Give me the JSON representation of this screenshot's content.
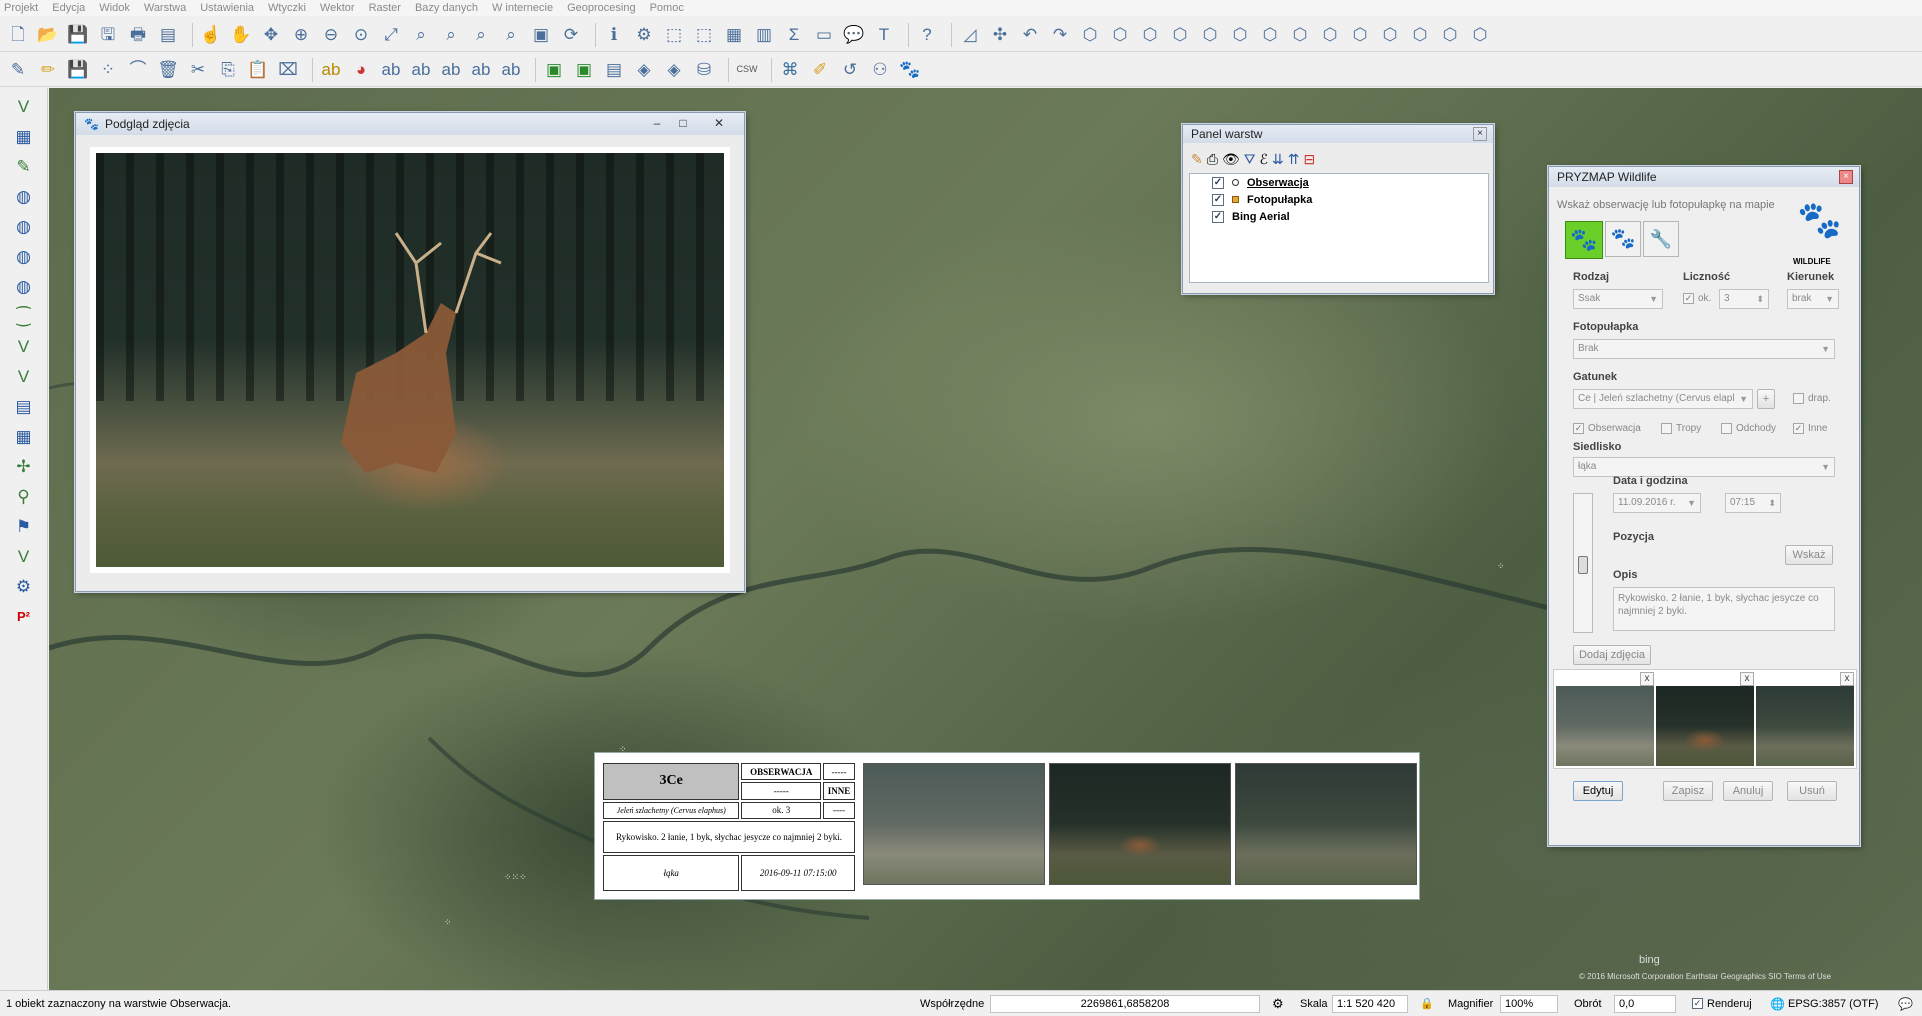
{
  "menubar": [
    "Projekt",
    "Edycja",
    "Widok",
    "Warstwa",
    "Ustawienia",
    "Wtyczki",
    "Wektor",
    "Raster",
    "Bazy danych",
    "W internecie",
    "Geoprocesing",
    "Pomoc"
  ],
  "icons": {
    "toolbar1": [
      "new-project-icon",
      "open-project-icon",
      "save-project-icon",
      "save-as-icon",
      "new-print-composer-icon",
      "composer-manager-icon",
      "touch-icon",
      "pan-icon",
      "pan-to-selection-icon",
      "zoom-in-icon",
      "zoom-out-icon",
      "zoom-native-icon",
      "zoom-full-icon",
      "zoom-to-selection-icon",
      "zoom-to-layer-icon",
      "zoom-last-icon",
      "zoom-next-icon",
      "new-map-view-icon",
      "refresh-icon",
      "identify-icon",
      "action-icon",
      "select-icon",
      "deselect-icon",
      "open-attribute-table-icon",
      "statistics-icon",
      "sum-icon",
      "measure-icon",
      "map-tips-icon",
      "text-annotation-icon",
      "help-icon",
      "digitize-icon",
      "move-feature-icon",
      "undo-icon",
      "redo-icon",
      "advanced-edit-icon"
    ],
    "toolbar2": [
      "current-edits-icon",
      "toggle-editing-icon",
      "save-edits-icon",
      "add-feature-icon",
      "node-tool-icon",
      "delete-selected-icon",
      "cut-icon",
      "copy-icon",
      "paste-icon",
      "label-icon",
      "diagram-icon",
      "label-pin-icon",
      "label-show-icon",
      "label-move-icon",
      "label-rotate-icon",
      "label-change-icon",
      "python-plugin-icon",
      "plugin-manager-icon",
      "map-layer-icon",
      "wms-icon",
      "wfs-icon",
      "database-icon",
      "csw-icon",
      "python-console-icon",
      "pencil-icon",
      "undo-blue-icon",
      "network-icon",
      "wildlife-paw-icon"
    ],
    "lefttb": [
      "add-vector-layer-icon",
      "add-raster-layer-icon",
      "add-postgis-icon",
      "add-spatialite-icon",
      "add-wms-icon",
      "add-wcs-icon",
      "add-wfs-icon",
      "add-csv-icon",
      "new-shapefile-icon",
      "new-spatialite-icon",
      "add-oracle-icon",
      "add-mssql-icon",
      "add-virtual-layer-icon",
      "gps-icon",
      "georeferencer-icon",
      "road-graph-icon",
      "processing-icon",
      "p2-icon"
    ]
  },
  "photo_window": {
    "title": "Podgląd zdjęcia"
  },
  "layers_panel": {
    "title": "Panel warstw",
    "layers": [
      {
        "name": "Obserwacja",
        "checked": true,
        "symbol": "circle"
      },
      {
        "name": "Fotopułapka",
        "checked": true,
        "symbol": "square"
      },
      {
        "name": "Bing Aerial",
        "checked": true,
        "symbol": ""
      }
    ]
  },
  "pryzmap": {
    "title": "PRYZMAP Wildlife",
    "hint": "Wskaż obserwację lub fotopułapkę na mapie",
    "logo_text": "WILDLIFE",
    "labels": {
      "rodzaj": "Rodzaj",
      "licznosc": "Liczność",
      "kierunek": "Kierunek",
      "fotopulapka": "Fotopułapka",
      "gatunek": "Gatunek",
      "siedlisko": "Siedlisko",
      "data": "Data i godzina",
      "pozycja": "Pozycja",
      "opis": "Opis"
    },
    "values": {
      "rodzaj": "Ssak",
      "ok_label": "ok.",
      "licznosc": "3",
      "kierunek": "brak",
      "fotopulapka": "Brak",
      "gatunek": "Ce | Jeleń szlachetny (Cervus elapl",
      "gatunek_add": "+",
      "drap": "drap.",
      "siedlisko": "łąka",
      "date": "11.09.2016 r.",
      "time": "07:15",
      "opis": "Rykowisko. 2 łanie, 1 byk, słychac jesycze co najmniej 2 byki."
    },
    "checks": {
      "obserwacja": "Obserwacja",
      "tropy": "Tropy",
      "odchody": "Odchody",
      "inne": "Inne"
    },
    "buttons": {
      "wskaz": "Wskaż",
      "dodaj": "Dodaj zdjęcia",
      "edytuj": "Edytuj",
      "zapisz": "Zapisz",
      "anuluj": "Anuluj",
      "usun": "Usuń"
    },
    "thumb_close": "x"
  },
  "popup": {
    "code": "3Ce",
    "type": "OBSERWACJA",
    "dash1": "-----",
    "dash2": "-----",
    "inne": "INNE",
    "species": "Jeleń szlachetny (Cervus elaphus)",
    "count": "ok. 3",
    "dash3": "----",
    "desc": "Rykowisko. 2 łanie, 1 byk, słychac jesycze co najmniej 2 byki.",
    "habitat": "łąka",
    "datetime": "2016-09-11 07:15:00"
  },
  "status": {
    "message": "1 obiekt zaznaczony na warstwie Obserwacja.",
    "coords_label": "Współrzędne",
    "coords": "2269861,6858208",
    "scale_label": "Skala",
    "scale": "1:1 520 420",
    "magnifier_label": "Magnifier",
    "magnifier": "100%",
    "rotation_label": "Obrót",
    "rotation": "0,0",
    "render_label": "Renderuj",
    "crs": "EPSG:3857 (OTF)"
  },
  "map_attribution": "© 2016 Microsoft Corporation Earthstar Geographics SIO Terms of Use",
  "bing_logo": "bing"
}
